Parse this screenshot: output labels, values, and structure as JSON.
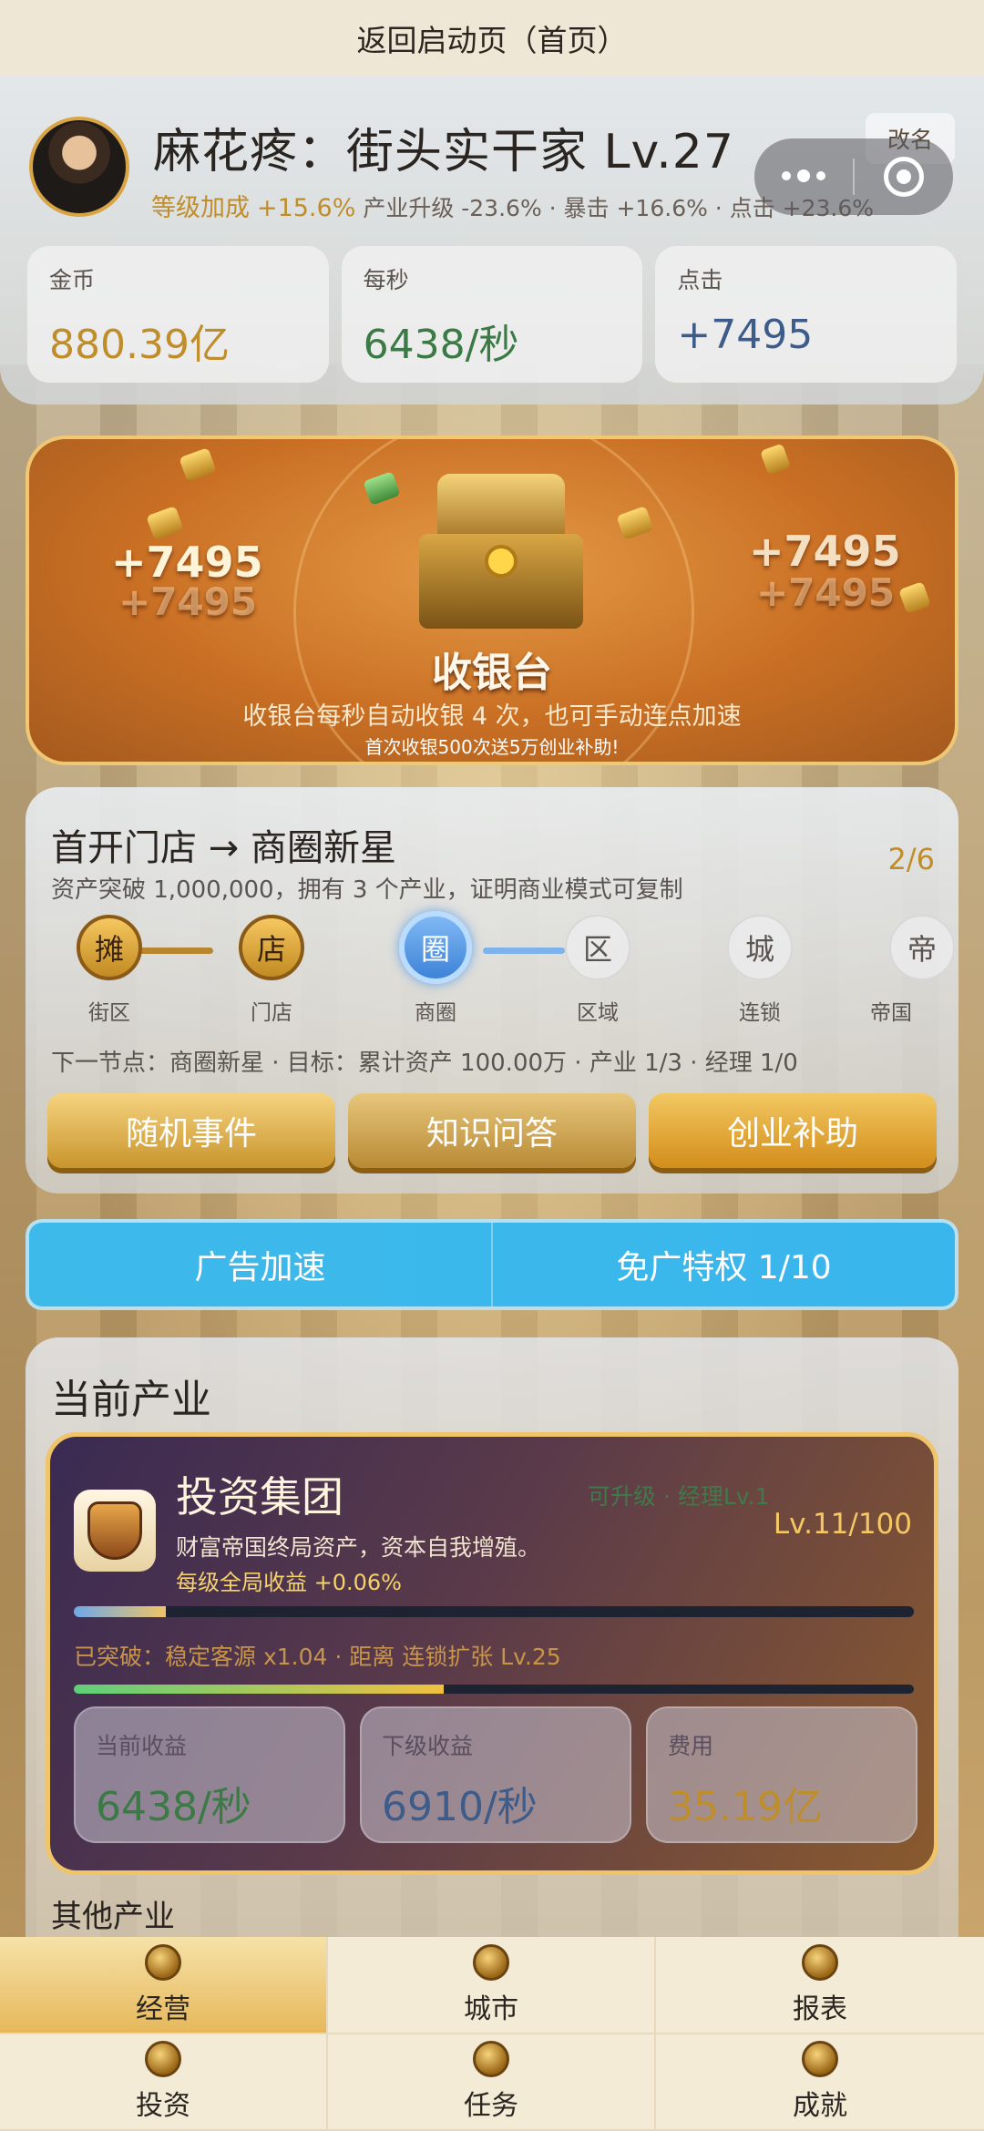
{
  "topbar": {
    "title": "返回启动页（首页）"
  },
  "profile": {
    "name": "麻花疼：街头实干家 Lv.27",
    "rename": "改名",
    "level_bonus_label": "等级加成",
    "level_bonus_value": "+15.6%",
    "bonus_rest": "产业升级 -23.6% · 暴击 +16.6% · 点击 +23.6%",
    "stats": [
      {
        "label": "金币",
        "value": "880.39亿"
      },
      {
        "label": "每秒",
        "value": "6438/秒"
      },
      {
        "label": "点击",
        "value": "+7495"
      }
    ]
  },
  "register": {
    "float_left": "+7495",
    "float_left_ghost": "+7495",
    "float_right": "+7495",
    "float_right_ghost": "+7495",
    "title": "收银台",
    "desc": "收银台每秒自动收银 4 次，也可手动连点加速",
    "promo": "首次收银500次送5万创业补助!"
  },
  "journey": {
    "title": "首开门店 → 商圈新星",
    "progress": "2/6",
    "desc": "资产突破 1,000,000，拥有 3 个产业，证明商业模式可复制",
    "nodes": [
      {
        "glyph": "摊",
        "label": "街区",
        "state": "done"
      },
      {
        "glyph": "店",
        "label": "门店",
        "state": "done"
      },
      {
        "glyph": "圈",
        "label": "商圈",
        "state": "current"
      },
      {
        "glyph": "区",
        "label": "区域",
        "state": "locked"
      },
      {
        "glyph": "城",
        "label": "连锁",
        "state": "locked"
      },
      {
        "glyph": "帝",
        "label": "帝国",
        "state": "locked"
      }
    ],
    "next": "下一节点：商圈新星 · 目标：累计资产 100.00万 · 产业 1/3 · 经理 1/0",
    "buttons": [
      "随机事件",
      "知识问答",
      "创业补助"
    ]
  },
  "ads": {
    "speedup": "广告加速",
    "noad": "免广特权 1/10"
  },
  "industry": {
    "heading": "当前产业",
    "name": "投资集团",
    "tag": "可升级 · 经理Lv.1",
    "level": "Lv.11/100",
    "desc": "财富帝国终局资产，资本自我增殖。",
    "bonus": "每级全局收益 +0.06%",
    "level_progress": 0.11,
    "breakthrough": "已突破：稳定客源 x1.04 · 距离 连锁扩张 Lv.25",
    "breakthrough_progress": 0.44,
    "minis": [
      {
        "label": "当前收益",
        "value": "6438/秒"
      },
      {
        "label": "下级收益",
        "value": "6910/秒"
      },
      {
        "label": "费用",
        "value": "35.19亿"
      }
    ],
    "other_heading": "其他产业"
  },
  "tabs": [
    "经营",
    "城市",
    "报表",
    "投资",
    "任务",
    "成就"
  ],
  "colors": {
    "gold": "#c08d2b",
    "green": "#3b7a45",
    "blue": "#3d5c8a",
    "ad_blue": "#3db9ea"
  }
}
